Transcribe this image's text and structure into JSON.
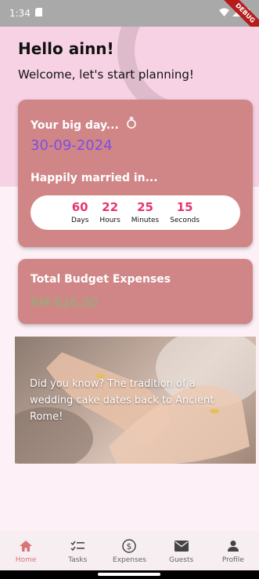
{
  "status_bar": {
    "time": "1:34"
  },
  "debug_banner": "DEBUG",
  "header": {
    "greeting": "Hello ainn!",
    "subtitle": "Welcome, let's start planning!"
  },
  "big_day_card": {
    "title": "Your big day...",
    "ring_icon": "ring-icon",
    "date": "30-09-2024",
    "countdown_title": "Happily married in...",
    "countdown": [
      {
        "value": "60",
        "label": "Days"
      },
      {
        "value": "22",
        "label": "Hours"
      },
      {
        "value": "25",
        "label": "Minutes"
      },
      {
        "value": "15",
        "label": "Seconds"
      }
    ]
  },
  "budget_card": {
    "title": "Total Budget Expenses",
    "amount": "RM 626.00"
  },
  "fact_card": {
    "text": "Did you know? The tradition of a wedding cake dates back to Ancient Rome!"
  },
  "bottom_nav": [
    {
      "label": "Home",
      "icon": "home-icon",
      "active": true
    },
    {
      "label": "Tasks",
      "icon": "checklist-icon",
      "active": false
    },
    {
      "label": "Expenses",
      "icon": "dollar-icon",
      "active": false
    },
    {
      "label": "Guests",
      "icon": "mail-icon",
      "active": false
    },
    {
      "label": "Profile",
      "icon": "person-icon",
      "active": false
    }
  ],
  "colors": {
    "accent": "#d08686",
    "header_bg": "#f7d2e4",
    "countdown_number": "#e8356c",
    "date_text": "#7a4ee6",
    "budget_amount": "#8fb17a"
  }
}
